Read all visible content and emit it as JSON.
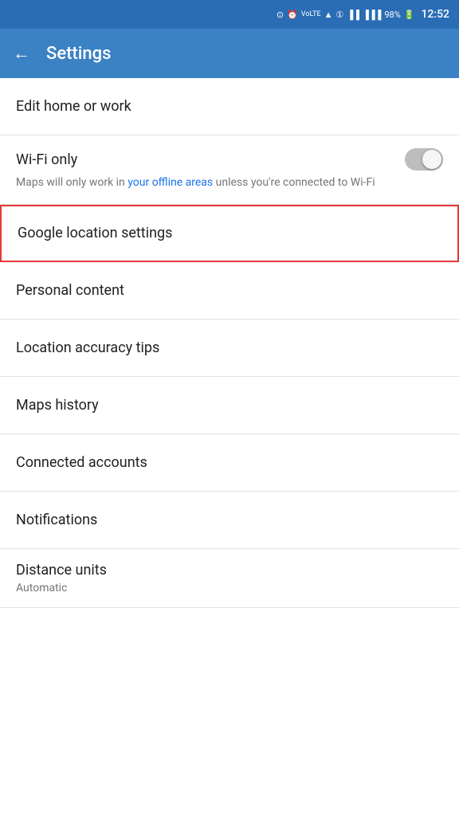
{
  "statusBar": {
    "battery": "98%",
    "time": "12:52",
    "icons": [
      "location",
      "alarm",
      "volte",
      "wifi",
      "sim1",
      "signal",
      "battery"
    ]
  },
  "appBar": {
    "title": "Settings",
    "backLabel": "←"
  },
  "settings": {
    "items": [
      {
        "id": "edit-home-work",
        "label": "Edit home or work",
        "type": "navigation"
      },
      {
        "id": "wifi-only",
        "label": "Wi-Fi only",
        "type": "toggle",
        "enabled": false,
        "description": "Maps will only work in ",
        "linkText": "your offline areas",
        "descriptionEnd": " unless you're connected to Wi-Fi"
      },
      {
        "id": "google-location-settings",
        "label": "Google location settings",
        "type": "navigation",
        "highlighted": true
      },
      {
        "id": "personal-content",
        "label": "Personal content",
        "type": "navigation"
      },
      {
        "id": "location-accuracy-tips",
        "label": "Location accuracy tips",
        "type": "navigation"
      },
      {
        "id": "maps-history",
        "label": "Maps history",
        "type": "navigation"
      },
      {
        "id": "connected-accounts",
        "label": "Connected accounts",
        "type": "navigation"
      },
      {
        "id": "notifications",
        "label": "Notifications",
        "type": "navigation"
      },
      {
        "id": "distance-units",
        "label": "Distance units",
        "subtitle": "Automatic",
        "type": "navigation-subtitle"
      }
    ],
    "wifi_description_before_link": "Maps will only work in ",
    "wifi_link_text": "your offline areas",
    "wifi_description_after_link": " unless you're connected to Wi-Fi"
  },
  "colors": {
    "appBarBg": "#3b82c4",
    "statusBarBg": "#2a6db5",
    "highlightBorder": "#e53935",
    "linkColor": "#1a73e8"
  }
}
